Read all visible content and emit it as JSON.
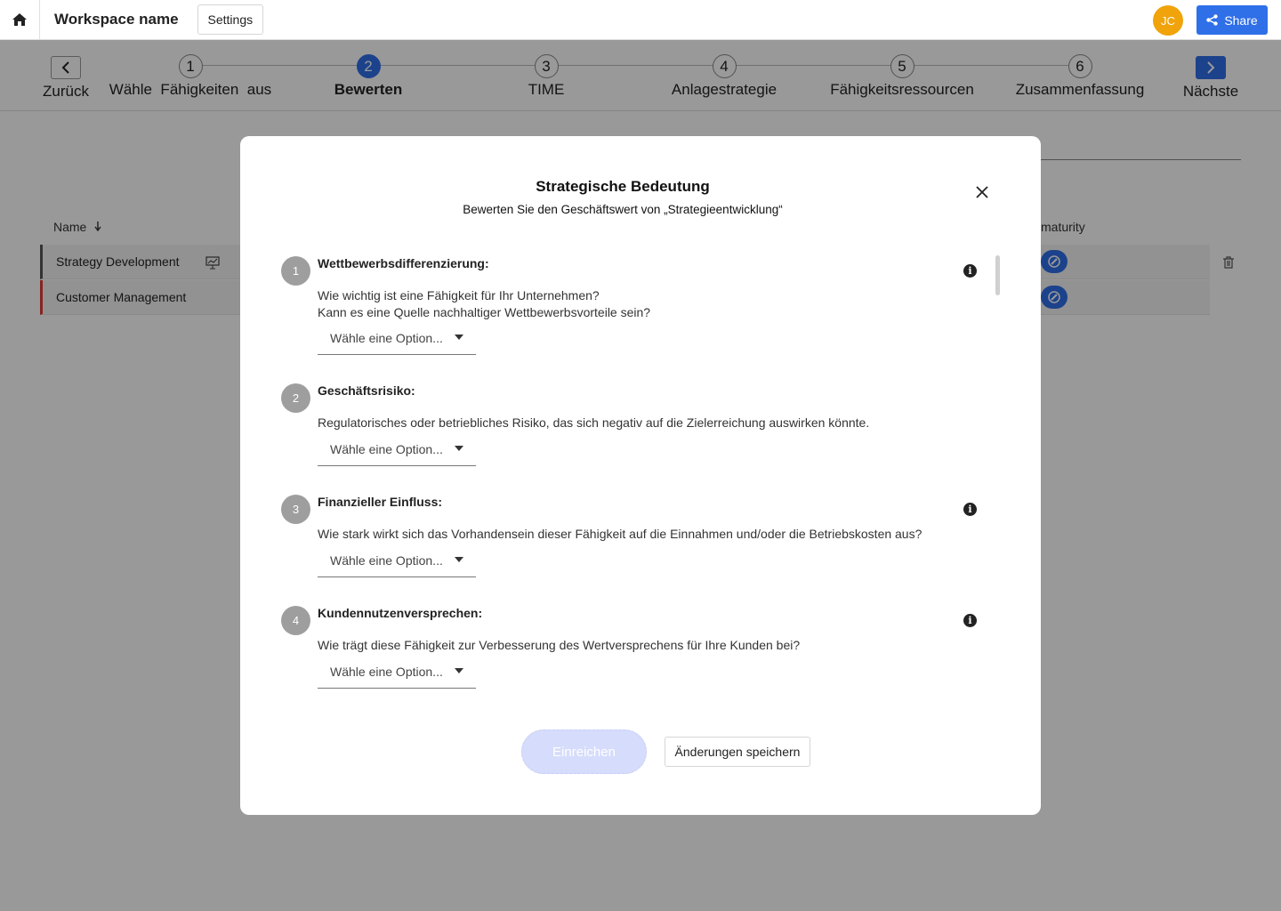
{
  "topbar": {
    "workspace_name": "Workspace name",
    "settings_label": "Settings",
    "avatar_initials": "JC",
    "avatar_color": "#f0a30a",
    "share_label": "Share",
    "accent_color": "#2f6fe8"
  },
  "stepper": {
    "back_label": "Zurück",
    "next_label": "Nächste",
    "steps": [
      {
        "num": "1",
        "label": "Wähle  Fähigkeiten  aus"
      },
      {
        "num": "2",
        "label": "Bewerten"
      },
      {
        "num": "3",
        "label": "TIME"
      },
      {
        "num": "4",
        "label": "Anlagestrategie"
      },
      {
        "num": "5",
        "label": "Fähigkeitsressourcen"
      },
      {
        "num": "6",
        "label": "Zusammenfassung"
      }
    ],
    "active_step": 2
  },
  "table": {
    "name_header": "Name",
    "maturity_header": "maturity",
    "rows": [
      {
        "label": "Strategy Development"
      },
      {
        "label": "Customer Management"
      }
    ]
  },
  "modal": {
    "title": "Strategische Bedeutung",
    "subtitle": "Bewerten Sie den Geschäftswert von „Strategieentwicklung“",
    "questions": [
      {
        "num": "1",
        "title": "Wettbewerbsdifferenzierung:",
        "line1": "Wie wichtig ist eine Fähigkeit für Ihr Unternehmen?",
        "line2": "Kann es eine Quelle nachhaltiger Wettbewerbsvorteile sein?",
        "select": "Wähle eine Option..."
      },
      {
        "num": "2",
        "title": "Geschäftsrisiko:",
        "line1": "Regulatorisches oder betriebliches Risiko, das sich negativ auf die Zielerreichung auswirken könnte.",
        "select": "Wähle eine Option..."
      },
      {
        "num": "3",
        "title": "Finanzieller Einfluss:",
        "line1": "Wie stark wirkt sich das Vorhandensein dieser Fähigkeit auf die Einnahmen und/oder die Betriebskosten aus?",
        "select": "Wähle eine Option..."
      },
      {
        "num": "4",
        "title": "Kundennutzenversprechen:",
        "line1": "Wie trägt diese Fähigkeit zur Verbesserung des Wertversprechens für Ihre Kunden bei?",
        "select": "Wähle eine Option..."
      }
    ],
    "submit_label": "Einreichen",
    "save_label": "Änderungen speichern"
  }
}
